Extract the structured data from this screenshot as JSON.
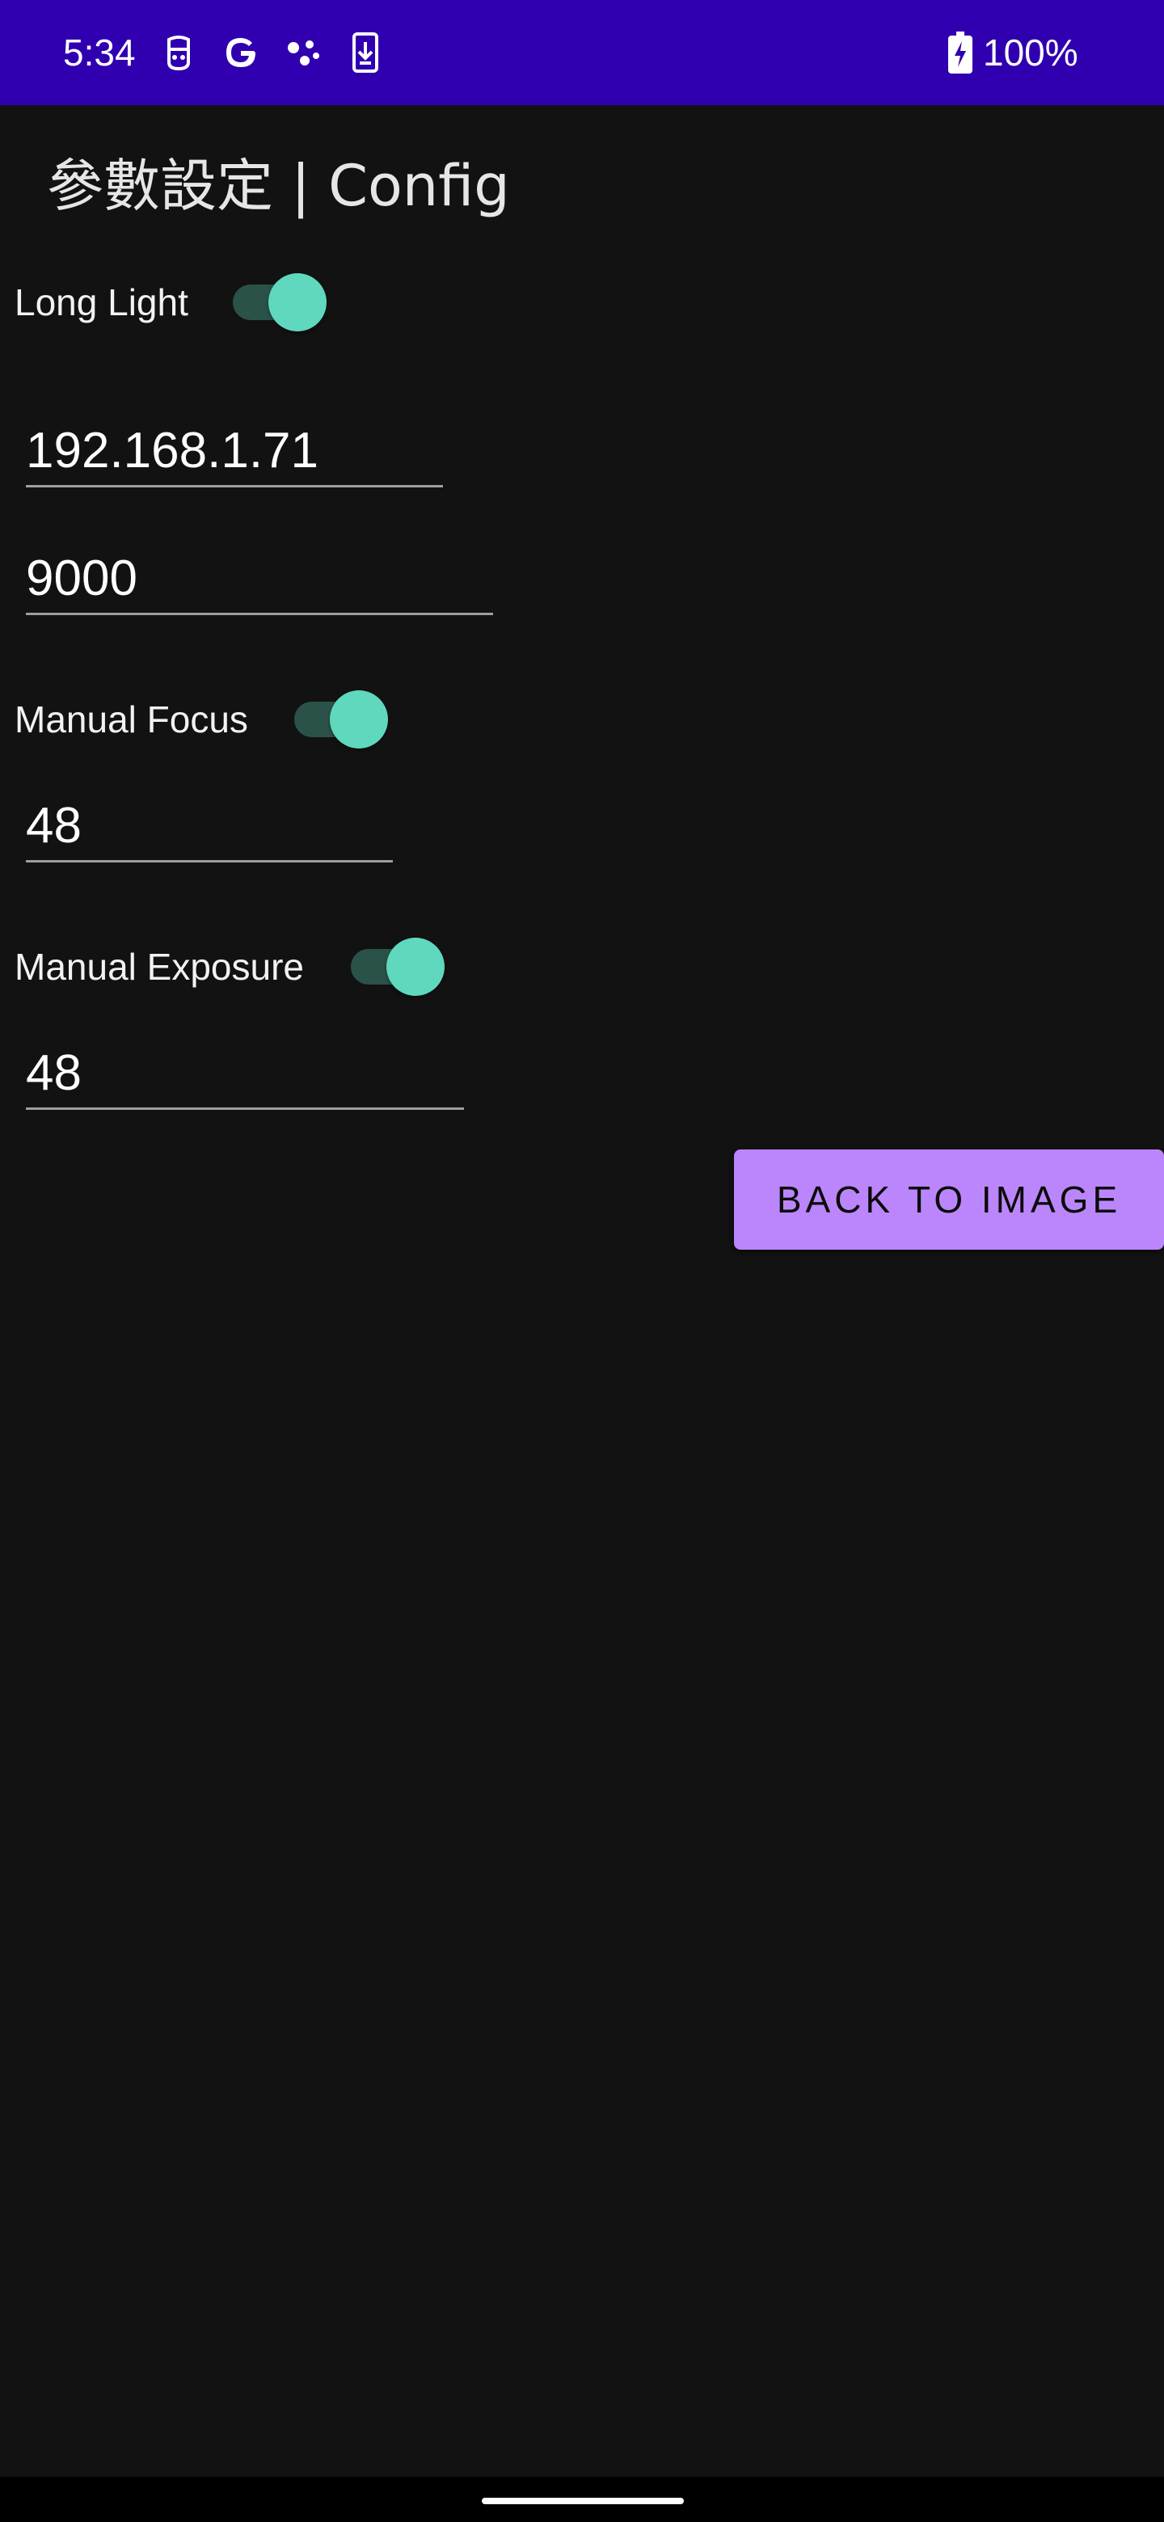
{
  "status_bar": {
    "time": "5:34",
    "battery_text": "100%",
    "background": "#3000b0",
    "icons": [
      "face-notification-icon",
      "google-icon",
      "assistant-dots-icon",
      "download-phone-icon",
      "battery-charging-icon"
    ]
  },
  "title": "參數設定 | Config",
  "long_light": {
    "label": "Long Light",
    "on": true
  },
  "ip_field": {
    "value": "192.168.1.71"
  },
  "port_field": {
    "value": "9000"
  },
  "manual_focus": {
    "label": "Manual Focus",
    "on": true,
    "value": "48"
  },
  "manual_exposure": {
    "label": "Manual Exposure",
    "on": true,
    "value": "48"
  },
  "back_button": {
    "label": "BACK TO IMAGE"
  },
  "colors": {
    "background": "#121212",
    "accent": "#bb86fc",
    "switch_thumb": "#5fd8bd",
    "switch_track": "#2b5249"
  }
}
